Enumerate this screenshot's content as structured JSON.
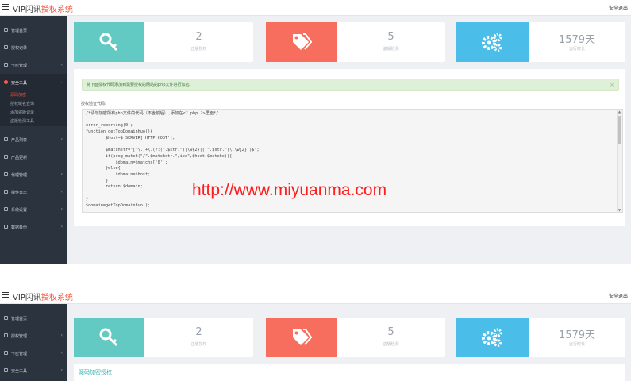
{
  "shot1": {
    "brand_main": "VIP闪讯",
    "brand_sub": "授权系统",
    "logout": "安全退出",
    "nav": [
      {
        "label": "管理首页",
        "chev": ""
      },
      {
        "label": "授权记录",
        "chev": ""
      },
      {
        "label": "卡密管理",
        "chev": "‹"
      },
      {
        "label": "安全工具",
        "chev": "⌄"
      }
    ],
    "subnav": [
      "源码加密",
      "授权域名查询",
      "添加盗版记录",
      "盗版检测工具"
    ],
    "nav2": [
      {
        "label": "产品列表",
        "chev": "‹"
      },
      {
        "label": "产品更新",
        "chev": ""
      },
      {
        "label": "代理管理",
        "chev": "‹"
      },
      {
        "label": "操作日志",
        "chev": "‹"
      },
      {
        "label": "系统设置",
        "chev": "‹"
      },
      {
        "label": "数据备份",
        "chev": "‹"
      }
    ],
    "stats": [
      {
        "num": "2",
        "cap": "正版授权"
      },
      {
        "num": "5",
        "cap": "盗版检测"
      },
      {
        "num": "1579天",
        "cap": "运行时长"
      }
    ],
    "alert": "将下面授权代码添加到需要授权的网站的php文件进行加密。",
    "close": "×",
    "code_label": "授权验证代码:",
    "code": "/*请勿加密所有php文件的代码（不含前后）,添加在<? php ?>里面*/\n\nerror_reporting(0);\nfunction getTopDomainhuo(){\n        $host=$_SERVER['HTTP_HOST'];\n\n        $matchstr=\"[^\\.]+\\.(?:(\".$str.\")|\\w{2}|((\".$str.\")\\.\\w{2}))$\";\n        if(preg_match(\"/\".$matchstr.\"/ies\",$host,$matchs)){\n            $domain=$matchs['0'];\n        }else{\n            $domain=$host;\n        }\n        return $domain;\n\n}\n$domain=getTopDomainhuo();"
  },
  "watermark": "http://www.miyuanma.com",
  "shot2": {
    "brand_main": "VIP闪讯",
    "brand_sub": "授权系统",
    "logout": "安全退出",
    "nav": [
      {
        "label": "管理首页",
        "chev": ""
      },
      {
        "label": "授权管理",
        "chev": "‹"
      },
      {
        "label": "卡密管理",
        "chev": "‹"
      },
      {
        "label": "安全工具",
        "chev": "‹"
      }
    ],
    "stats": [
      {
        "num": "2",
        "cap": "正版授权"
      },
      {
        "num": "5",
        "cap": "盗版检测"
      },
      {
        "num": "1579天",
        "cap": "运行时长"
      }
    ],
    "panel_title": "源码加密授权"
  },
  "icons": [
    "menu-icon",
    "key-icon",
    "tags-icon",
    "gears-icon"
  ],
  "colors": {
    "sidebar": "#2b333e",
    "teal": "#62c9c3",
    "coral": "#f76d5e",
    "blue": "#4bbde9",
    "brand_red": "#f0533f",
    "watermark": "#ff1c1c"
  }
}
